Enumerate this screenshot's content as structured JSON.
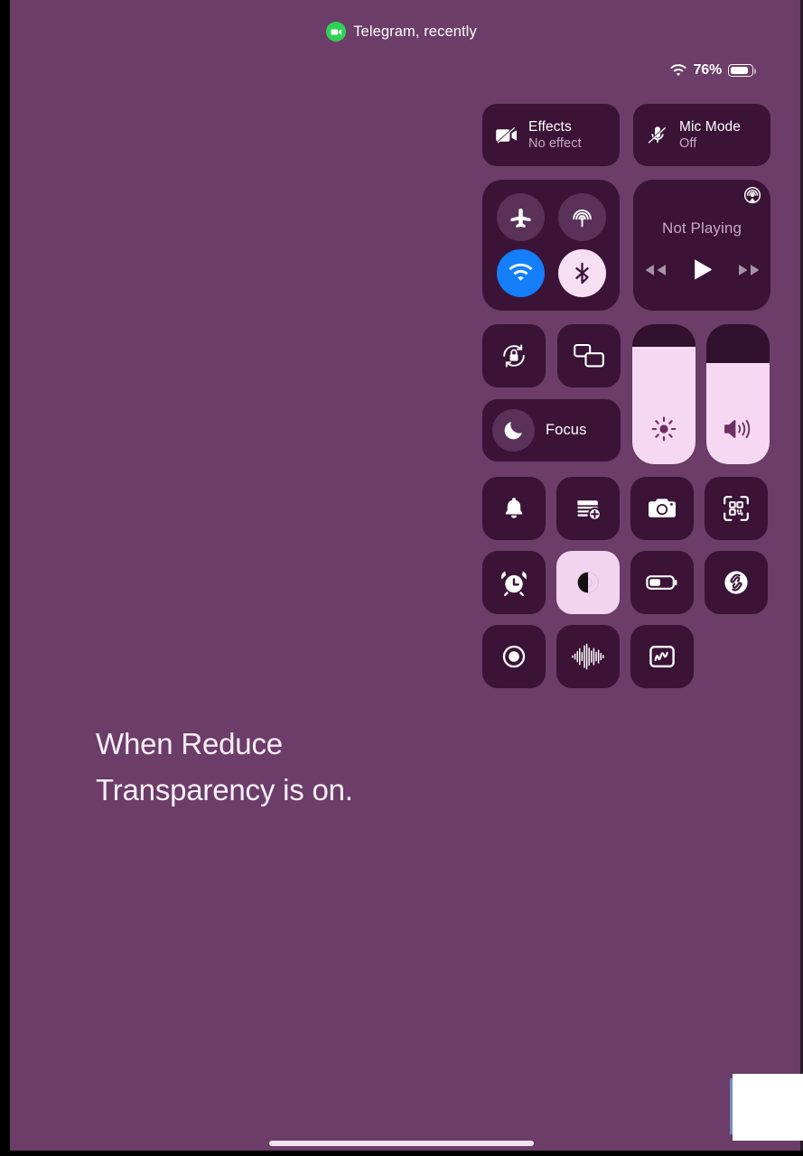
{
  "status_bar": {
    "call_indicator": {
      "icon": "video-camera-icon",
      "text": "Telegram, recently"
    },
    "wifi_icon": "wifi-icon",
    "battery_percent": "76%",
    "battery_level": 74,
    "battery_icon": "battery-icon"
  },
  "control_center": {
    "effects": {
      "icon": "video-off-icon",
      "title": "Effects",
      "subtitle": "No effect"
    },
    "mic_mode": {
      "icon": "mic-off-icon",
      "title": "Mic Mode",
      "subtitle": "Off"
    },
    "connectivity": [
      {
        "name": "airplane-mode",
        "icon": "airplane-icon",
        "state": "off"
      },
      {
        "name": "airdrop",
        "icon": "airdrop-icon",
        "state": "off"
      },
      {
        "name": "wifi",
        "icon": "wifi-icon",
        "state": "on"
      },
      {
        "name": "bluetooth",
        "icon": "bluetooth-icon",
        "state": "on"
      }
    ],
    "now_playing": {
      "title": "Not Playing",
      "airplay_icon": "airplay-audio-icon",
      "previous_icon": "rewind-icon",
      "play_icon": "play-icon",
      "next_icon": "fast-forward-icon"
    },
    "rotation_lock": {
      "icon": "rotation-lock-icon",
      "state": "off"
    },
    "screen_mirroring": {
      "icon": "screen-mirroring-icon",
      "state": "off"
    },
    "focus": {
      "icon": "moon-icon",
      "label": "Focus",
      "state": "off"
    },
    "brightness": {
      "icon": "brightness-icon",
      "value": 84
    },
    "volume": {
      "icon": "speaker-icon",
      "value": 72
    },
    "grid": [
      {
        "name": "silent-mode",
        "icon": "bell-icon",
        "state": "off"
      },
      {
        "name": "quick-note",
        "icon": "note-add-icon",
        "state": "off"
      },
      {
        "name": "camera",
        "icon": "camera-icon",
        "state": "off"
      },
      {
        "name": "code-scanner",
        "icon": "qr-scanner-icon",
        "state": "off"
      },
      {
        "name": "alarm",
        "icon": "alarm-clock-icon",
        "state": "off"
      },
      {
        "name": "dark-mode",
        "icon": "dark-mode-icon",
        "state": "on"
      },
      {
        "name": "low-power-mode",
        "icon": "battery-half-icon",
        "state": "off"
      },
      {
        "name": "shazam",
        "icon": "shazam-icon",
        "state": "off"
      },
      {
        "name": "screen-recording",
        "icon": "record-icon",
        "state": "off"
      },
      {
        "name": "voice-memos",
        "icon": "waveform-icon",
        "state": "off"
      },
      {
        "name": "stocks",
        "icon": "stocks-icon",
        "state": "off"
      }
    ]
  },
  "caption": {
    "line1": "When Reduce",
    "line2": "Transparency is on."
  },
  "colors": {
    "wallpaper": "#6b3d68",
    "tile": "#3a1337",
    "tile_active": "#f3d4ef",
    "slider_fill": "#f7d8f2",
    "wifi_on": "#147efb",
    "bluetooth_on": "#f7dff3",
    "call_green": "#30d158",
    "text_primary": "#ffffff",
    "text_secondary": "#c7a7c4"
  }
}
